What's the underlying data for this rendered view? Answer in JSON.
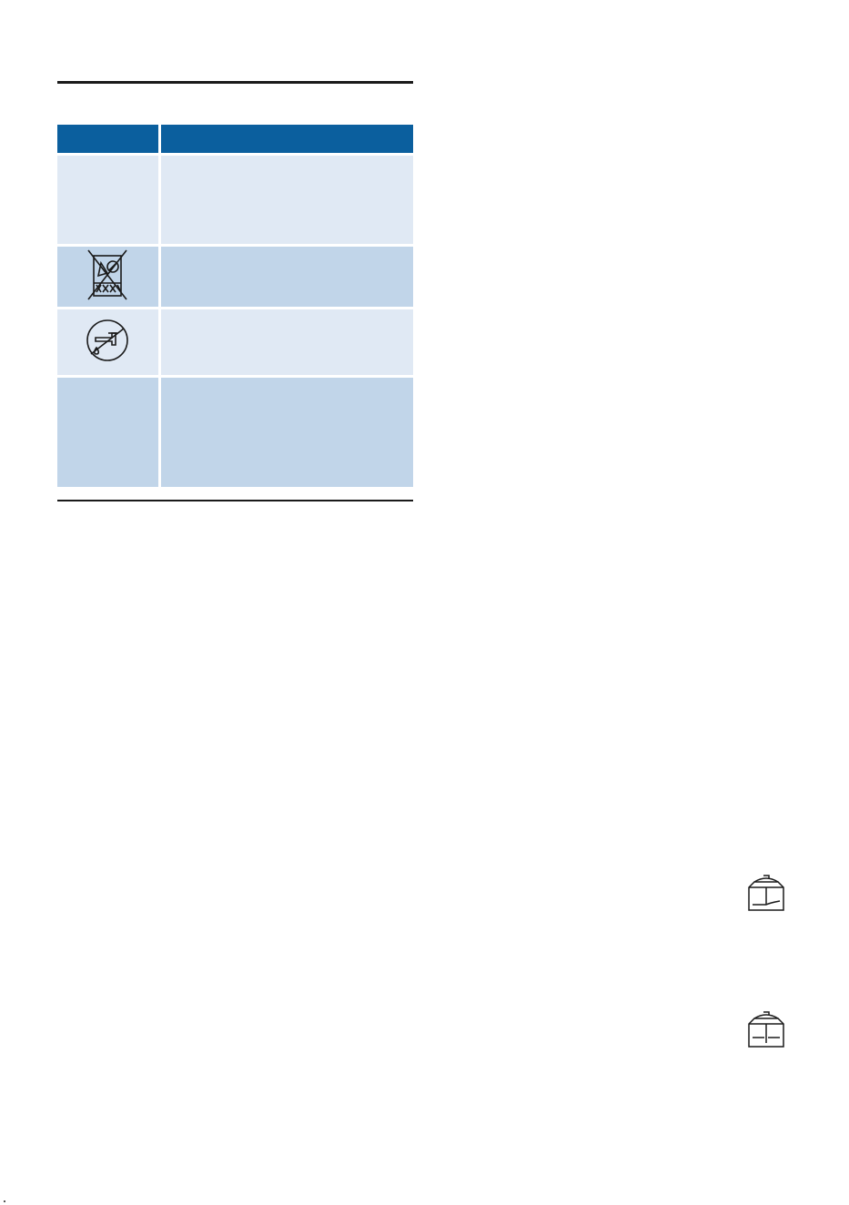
{
  "table": {
    "rows": [
      {
        "symbol": "",
        "description": ""
      },
      {
        "symbol": "no-dishwasher-icon",
        "description": ""
      },
      {
        "symbol": "no-water-tap-icon",
        "description": ""
      },
      {
        "symbol": "",
        "description": ""
      }
    ]
  },
  "side_icons": [
    "blender-jug-icon",
    "blender-jug-icon"
  ],
  "colors": {
    "header": "#0b5f9e",
    "row_light": "#e0e9f4",
    "row_dark": "#c1d5e9"
  }
}
